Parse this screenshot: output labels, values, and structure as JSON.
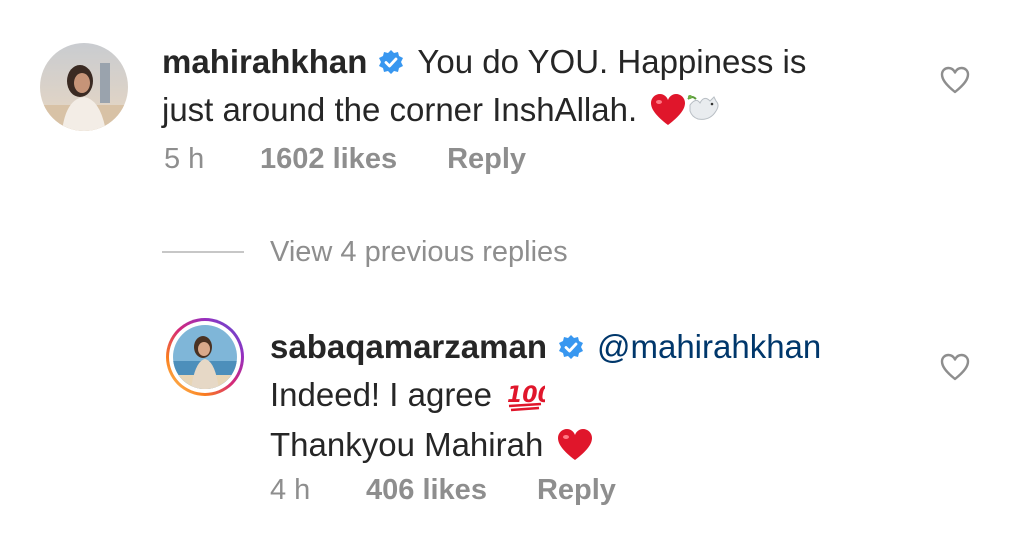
{
  "comments": [
    {
      "username": "mahirahkhan",
      "text_line1": "You do YOU. Happiness is",
      "text_line2": "just around the corner InshAllah.",
      "emojis": [
        "red-heart",
        "dove-of-peace"
      ],
      "time": "5 h",
      "likes": "1602 likes",
      "reply_label": "Reply"
    }
  ],
  "view_previous": "View 4 previous replies",
  "reply": {
    "username": "sabaqamarzaman",
    "mention": "@mahirahkhan",
    "text_line1": "Indeed! I agree",
    "text_line2": "Thankyou Mahirah",
    "emojis": [
      "hundred-points",
      "red-heart"
    ],
    "time": "4 h",
    "likes": "406 likes",
    "reply_label": "Reply"
  },
  "colors": {
    "text": "#262626",
    "secondary": "#8e8e8e",
    "mention": "#00376b",
    "verified": "#3897f0",
    "heart": "#e0162b"
  }
}
